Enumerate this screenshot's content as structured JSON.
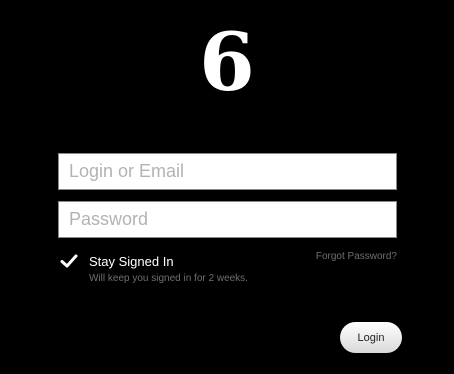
{
  "logo": {
    "text": "6"
  },
  "form": {
    "login_placeholder": "Login or Email",
    "password_placeholder": "Password",
    "stay_signed_in_label": "Stay Signed In",
    "stay_signed_in_hint": "Will keep you signed in for 2 weeks.",
    "stay_signed_in_checked": true,
    "forgot_password_label": "Forgot Password?",
    "login_button_label": "Login"
  },
  "colors": {
    "background": "#000000",
    "field_background": "#ffffff",
    "placeholder": "#b3b3b3",
    "muted_text": "#6f6f6f",
    "check_mark": "#ffffff"
  },
  "icons": {
    "stay_signed_in": "checkmark-icon"
  }
}
